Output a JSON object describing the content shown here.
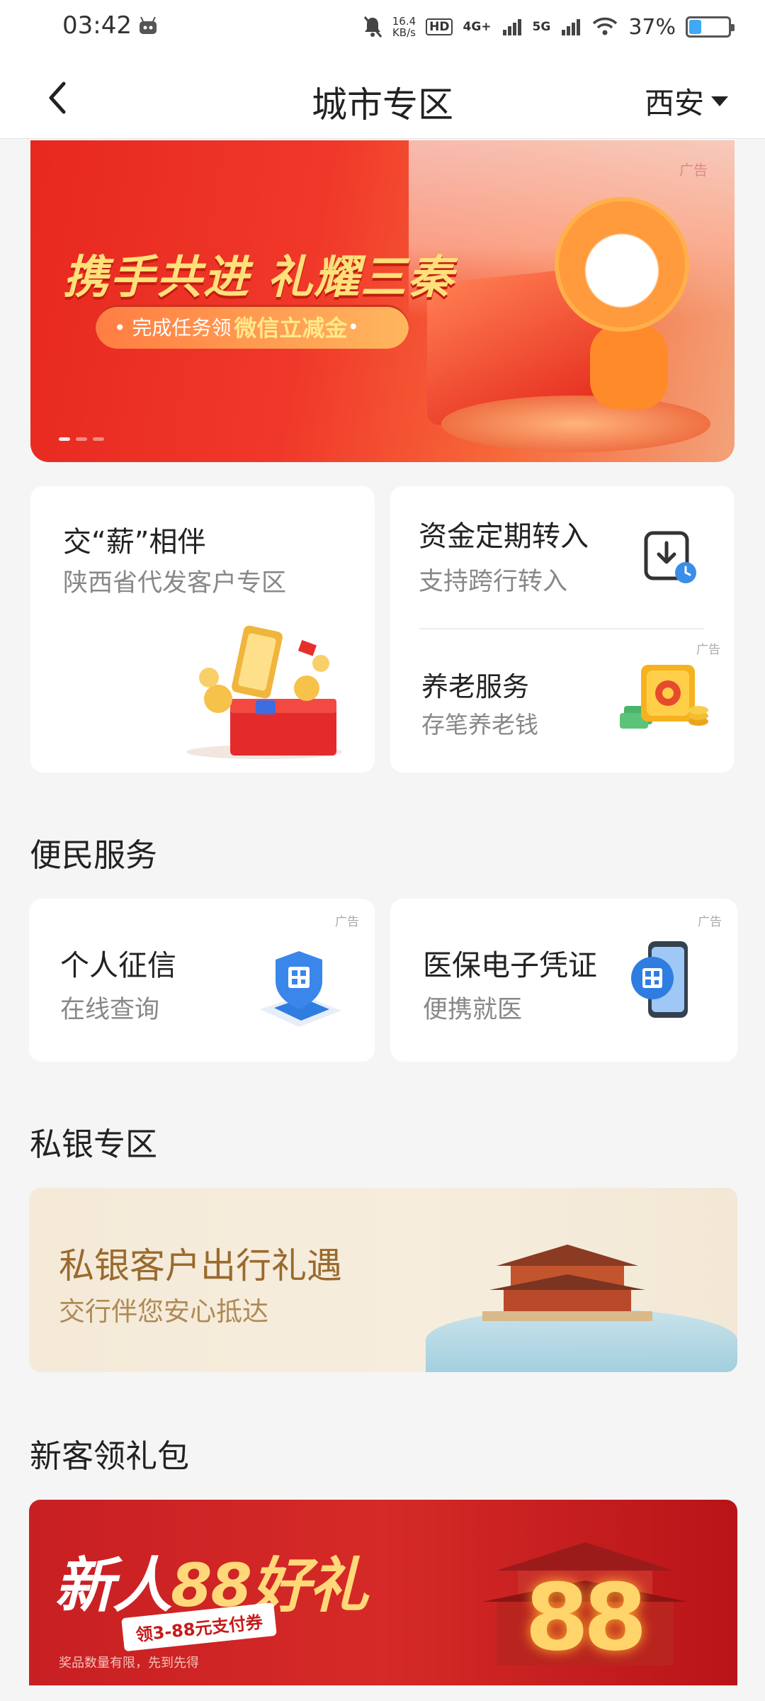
{
  "status_bar": {
    "time": "03:42",
    "speed_value": "16.4",
    "speed_unit": "KB/s",
    "hd": "HD",
    "net_4g": "4G+",
    "net_5g": "5G",
    "battery": "37%",
    "battery_level": 0.37
  },
  "nav": {
    "title": "城市专区",
    "city": "西安"
  },
  "banner": {
    "ad_label": "广告",
    "headline": "携手共进 礼耀三秦",
    "pill_prefix": "• 完成任务领",
    "pill_highlight": "微信立减金",
    "pill_suffix": " •"
  },
  "cards": {
    "salary": {
      "title": "交“薪”相伴",
      "subtitle": "陕西省代发客户专区"
    },
    "fixed_transfer": {
      "title": "资金定期转入",
      "subtitle": "支持跨行转入"
    },
    "pension": {
      "ad_label": "广告",
      "title": "养老服务",
      "subtitle": "存笔养老钱"
    }
  },
  "convenience": {
    "section_title": "便民服务",
    "credit": {
      "ad_label": "广告",
      "title": "个人征信",
      "subtitle": "在线查询"
    },
    "medical": {
      "ad_label": "广告",
      "title": "医保电子凭证",
      "subtitle": "便携就医"
    }
  },
  "private_bank": {
    "section_title": "私银专区",
    "title": "私银客户出行礼遇",
    "subtitle": "交行伴您安心抵达"
  },
  "new_customer": {
    "section_title": "新客领礼包",
    "headline_a": "新人",
    "headline_b": "88好礼",
    "coupon": "领3-88元支付券",
    "tip": "奖品数量有限，先到先得",
    "big_number": "88"
  }
}
